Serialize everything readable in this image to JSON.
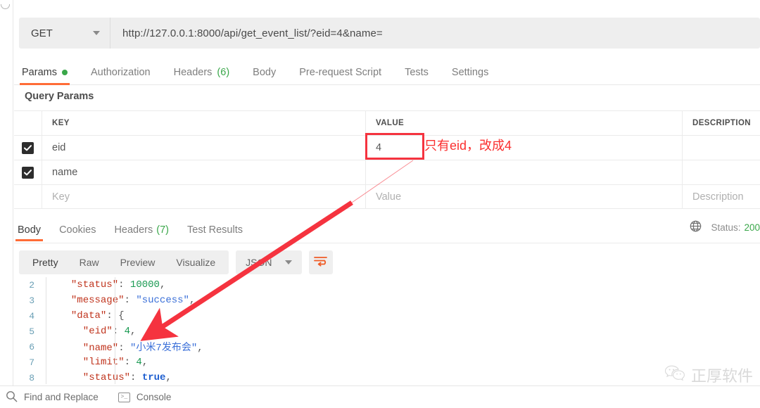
{
  "request": {
    "method": "GET",
    "method_icon": "chevron-down-icon",
    "url": "http://127.0.0.1:8000/api/get_event_list/?eid=4&name=",
    "tabs": [
      {
        "label": "Params",
        "indicator": "dot",
        "active": true
      },
      {
        "label": "Authorization",
        "active": false
      },
      {
        "label": "Headers",
        "count": "(6)",
        "active": false
      },
      {
        "label": "Body",
        "active": false
      },
      {
        "label": "Pre-request Script",
        "active": false
      },
      {
        "label": "Tests",
        "active": false
      },
      {
        "label": "Settings",
        "active": false
      }
    ]
  },
  "query_params": {
    "section_title": "Query Params",
    "headers": {
      "key": "KEY",
      "value": "VALUE",
      "description": "DESCRIPTION"
    },
    "rows": [
      {
        "checked": true,
        "key": "eid",
        "value": "4",
        "description": "",
        "highlighted": true
      },
      {
        "checked": true,
        "key": "name",
        "value": "",
        "description": "",
        "highlighted": false
      }
    ],
    "placeholder_row": {
      "key": "Key",
      "value": "Value",
      "description": "Description"
    }
  },
  "annotation": {
    "text": "只有eid，改成4",
    "color": "#fb2f2f",
    "box_color": "#f5333f",
    "arrow_from": "value-cell-eid",
    "arrow_to": "json-line-eid"
  },
  "response": {
    "tabs": [
      {
        "label": "Body",
        "active": true
      },
      {
        "label": "Cookies",
        "active": false
      },
      {
        "label": "Headers",
        "count": "(7)",
        "active": false
      },
      {
        "label": "Test Results",
        "active": false
      }
    ],
    "globe_icon": "globe-icon",
    "status_label": "Status:",
    "status_code": "200",
    "format_tabs": [
      {
        "label": "Pretty",
        "active": true
      },
      {
        "label": "Raw",
        "active": false
      },
      {
        "label": "Preview",
        "active": false
      },
      {
        "label": "Visualize",
        "active": false
      }
    ],
    "content_type": "JSON",
    "content_type_icon": "chevron-down-icon",
    "wrap_icon": "word-wrap-icon",
    "body_lines": [
      {
        "num": "2",
        "indent": 2,
        "tokens": [
          {
            "t": "\"status\"",
            "c": "k"
          },
          {
            "t": ": ",
            "c": "p"
          },
          {
            "t": "10000",
            "c": "num"
          },
          {
            "t": ",",
            "c": "p"
          }
        ]
      },
      {
        "num": "3",
        "indent": 2,
        "tokens": [
          {
            "t": "\"message\"",
            "c": "k"
          },
          {
            "t": ": ",
            "c": "p"
          },
          {
            "t": "\"success\"",
            "c": "str"
          },
          {
            "t": ",",
            "c": "p"
          }
        ]
      },
      {
        "num": "4",
        "indent": 2,
        "tokens": [
          {
            "t": "\"data\"",
            "c": "k"
          },
          {
            "t": ": {",
            "c": "p"
          }
        ]
      },
      {
        "num": "5",
        "indent": 4,
        "tokens": [
          {
            "t": "\"eid\"",
            "c": "k"
          },
          {
            "t": ": ",
            "c": "p"
          },
          {
            "t": "4",
            "c": "num"
          },
          {
            "t": ",",
            "c": "p"
          }
        ]
      },
      {
        "num": "6",
        "indent": 4,
        "tokens": [
          {
            "t": "\"name\"",
            "c": "k"
          },
          {
            "t": ": ",
            "c": "p"
          },
          {
            "t": "\"小米7发布会\"",
            "c": "str"
          },
          {
            "t": ",",
            "c": "p"
          }
        ]
      },
      {
        "num": "7",
        "indent": 4,
        "tokens": [
          {
            "t": "\"limit\"",
            "c": "k"
          },
          {
            "t": ": ",
            "c": "p"
          },
          {
            "t": "4",
            "c": "num"
          },
          {
            "t": ",",
            "c": "p"
          }
        ]
      },
      {
        "num": "8",
        "indent": 4,
        "tokens": [
          {
            "t": "\"status\"",
            "c": "k"
          },
          {
            "t": ": ",
            "c": "p"
          },
          {
            "t": "true",
            "c": "bool"
          },
          {
            "t": ",",
            "c": "p"
          }
        ]
      }
    ]
  },
  "watermark": {
    "text": "正厚软件",
    "icon": "wechat-icon"
  },
  "footer": {
    "find_replace": {
      "label": "Find and Replace",
      "icon": "search-icon"
    },
    "console": {
      "label": "Console",
      "icon": "terminal-icon"
    }
  }
}
